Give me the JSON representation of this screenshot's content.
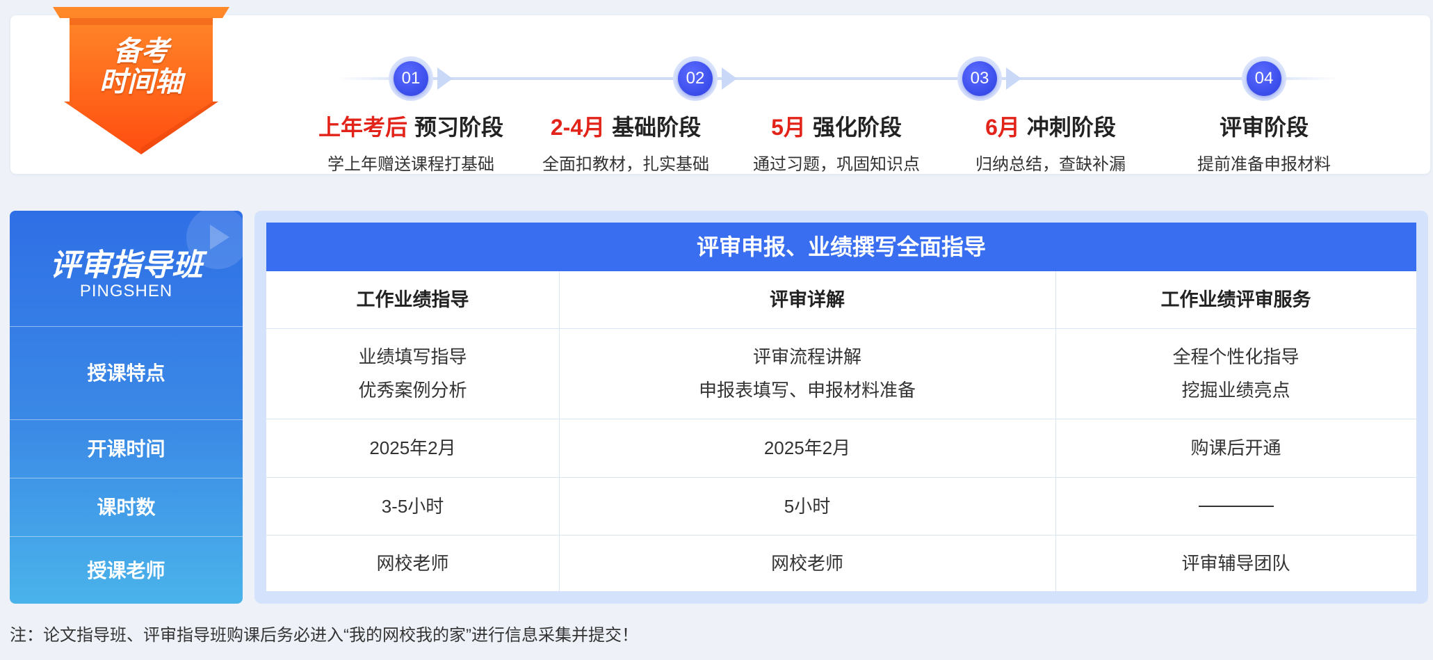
{
  "timeline": {
    "badge_line1": "备考",
    "badge_line2": "时间轴",
    "steps": [
      {
        "num": "01",
        "highlight": "上年考后",
        "title": "预习阶段",
        "desc": "学上年赠送课程打基础"
      },
      {
        "num": "02",
        "highlight": "2-4月",
        "title": "基础阶段",
        "desc": "全面扣教材，扎实基础"
      },
      {
        "num": "03",
        "highlight": "5月",
        "title": "强化阶段",
        "desc": "通过习题，巩固知识点"
      },
      {
        "num": "04",
        "highlight": "6月",
        "title": "冲刺阶段",
        "desc": "归纳总结，查缺补漏"
      },
      {
        "num": "",
        "highlight": "",
        "title": "评审阶段",
        "desc": "提前准备申报材料"
      }
    ]
  },
  "panel": {
    "title": "评审指导班",
    "subtitle": "PINGSHEN",
    "rows": [
      "授课特点",
      "开课时间",
      "课时数",
      "授课老师"
    ]
  },
  "table": {
    "header": "评审申报、业绩撰写全面指导",
    "columns": [
      "工作业绩指导",
      "评审详解",
      "工作业绩评审服务"
    ],
    "features": [
      [
        "业绩填写指导",
        "优秀案例分析"
      ],
      [
        "评审流程讲解",
        "申报表填写、申报材料准备"
      ],
      [
        "全程个性化指导",
        "挖掘业绩亮点"
      ]
    ],
    "start_time": [
      "2025年2月",
      "2025年2月",
      "购课后开通"
    ],
    "hours": [
      "3-5小时",
      "5小时",
      ""
    ],
    "teachers": [
      "网校老师",
      "网校老师",
      "评审辅导团队"
    ]
  },
  "note": "注：论文指导班、评审指导班购课后务必进入“我的网校我的家”进行信息采集并提交！",
  "colors": {
    "accent_blue": "#3a6ef0",
    "highlight_red": "#e2231a",
    "badge_orange": "#ff6a1a"
  }
}
